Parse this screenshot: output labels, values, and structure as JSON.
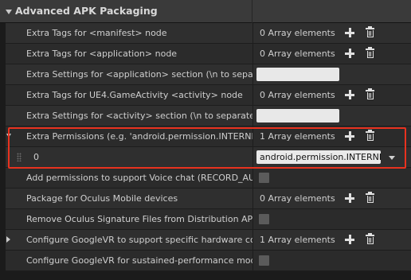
{
  "section": {
    "title": "Advanced APK Packaging"
  },
  "rows": [
    {
      "label": "Extra Tags for <manifest> node",
      "count": "0 Array elements"
    },
    {
      "label": "Extra Tags for <application> node",
      "count": "0 Array elements"
    },
    {
      "label": "Extra Settings for <application> section (\\n to separate li"
    },
    {
      "label": "Extra Tags for UE4.GameActivity <activity> node",
      "count": "0 Array elements"
    },
    {
      "label": "Extra Settings for <activity> section (\\n to separate lines"
    },
    {
      "label": "Extra Permissions (e.g. 'android.permission.INTERNET')",
      "count": "1 Array elements"
    },
    {
      "index": "0",
      "value": "android.permission.INTERNET"
    },
    {
      "label": "Add permissions to support Voice chat (RECORD_AUDIO)"
    },
    {
      "label": "Package for Oculus Mobile devices",
      "count": "0 Array elements"
    },
    {
      "label": "Remove Oculus Signature Files from Distribution APK"
    },
    {
      "label": "Configure GoogleVR to support specific hardware configu",
      "count": "1 Array elements"
    },
    {
      "label": "Configure GoogleVR for sustained-performance mode"
    }
  ],
  "highlight_color": "#e8321f"
}
